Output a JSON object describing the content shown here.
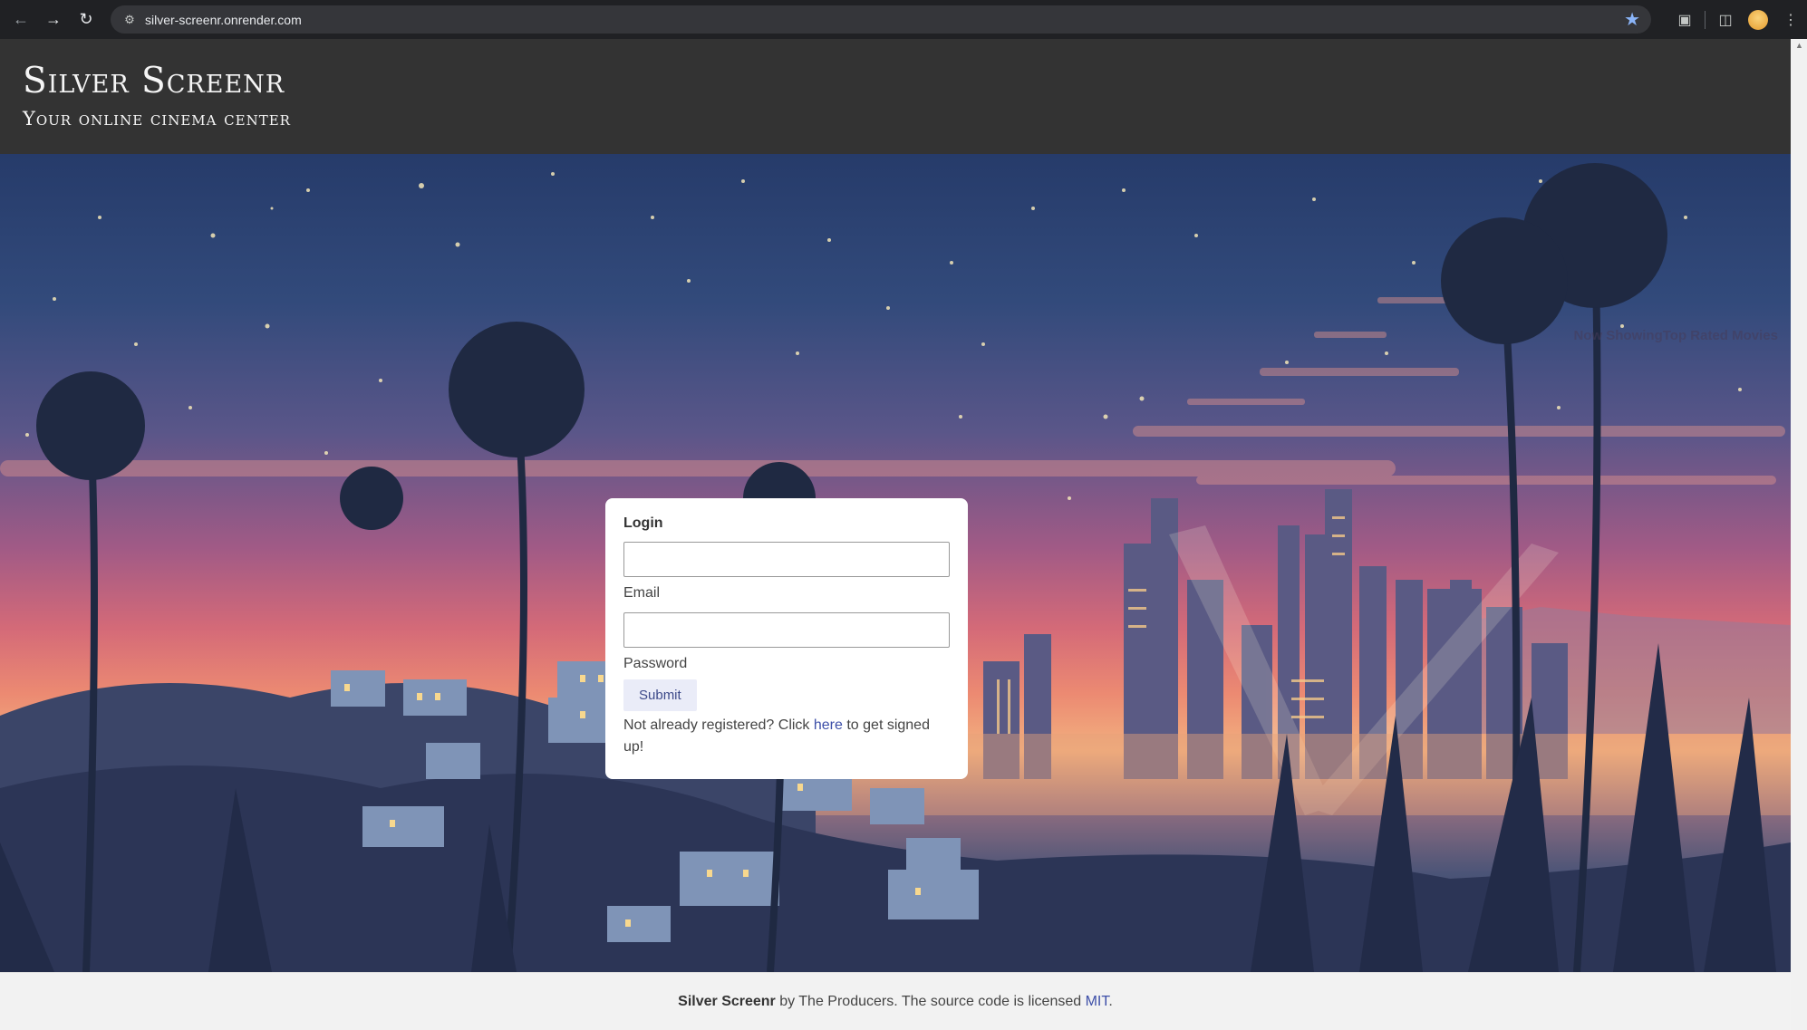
{
  "browser": {
    "url": "silver-screenr.onrender.com",
    "icons": [
      "back-icon",
      "forward-icon",
      "reload-icon",
      "site-info-icon",
      "bookmark-star-icon",
      "extensions-icon",
      "side-panel-icon",
      "profile-avatar",
      "menu-icon"
    ]
  },
  "header": {
    "title": "Silver Screenr",
    "subtitle": "Your online cinema center"
  },
  "hero": {
    "now_showing": "Now ShowingTop Rated Movies"
  },
  "login": {
    "title": "Login",
    "email_label": "Email",
    "email_value": "",
    "password_label": "Password",
    "password_value": "",
    "submit_label": "Submit",
    "register_prefix": "Not already registered? Click ",
    "register_link": "here",
    "register_suffix": " to get signed up!"
  },
  "footer": {
    "brand": "Silver Screenr",
    "text": " by The Producers. The source code is licensed ",
    "license_link": "MIT",
    "end": "."
  },
  "colors": {
    "header_bg": "#333333",
    "link": "#3d4fa8",
    "submit_bg": "#eaecf8"
  }
}
